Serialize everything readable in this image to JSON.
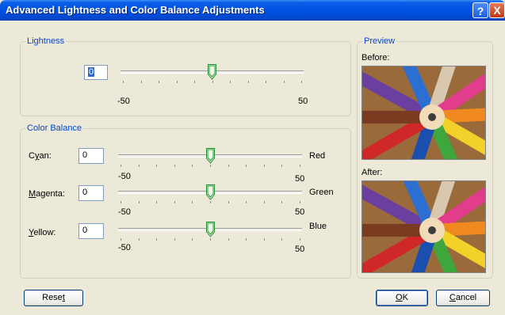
{
  "window": {
    "title": "Advanced Lightness and Color Balance Adjustments",
    "help_label": "?",
    "close_label": "X"
  },
  "lightness": {
    "group_label": "Lightness",
    "value": "0",
    "min_label": "-50",
    "max_label": "50",
    "slider_value": 0
  },
  "color_balance": {
    "group_label": "Color Balance",
    "rows": [
      {
        "label_pre": "C",
        "label_key": "y",
        "label_post": "an:",
        "value": "0",
        "right_label": "Red",
        "min_label": "-50",
        "max_label": "50",
        "slider_value": 0
      },
      {
        "label_pre": "",
        "label_key": "M",
        "label_post": "agenta:",
        "value": "0",
        "right_label": "Green",
        "min_label": "-50",
        "max_label": "50",
        "slider_value": 0
      },
      {
        "label_pre": "",
        "label_key": "Y",
        "label_post": "ellow:",
        "value": "0",
        "right_label": "Blue",
        "min_label": "-50",
        "max_label": "50",
        "slider_value": 0
      }
    ]
  },
  "preview": {
    "group_label": "Preview",
    "before_label": "Before:",
    "after_label": "After:"
  },
  "buttons": {
    "reset_pre": "Rese",
    "reset_key": "t",
    "reset_post": "",
    "ok_pre": "",
    "ok_key": "O",
    "ok_post": "K",
    "cancel_pre": "",
    "cancel_key": "C",
    "cancel_post": "ancel"
  },
  "colors": {
    "titlebar": "#0053e1",
    "group_label": "#0046d5",
    "dialog_bg": "#ece9d8"
  },
  "icons": [
    "help-icon",
    "close-icon",
    "slider-thumb-icon"
  ]
}
